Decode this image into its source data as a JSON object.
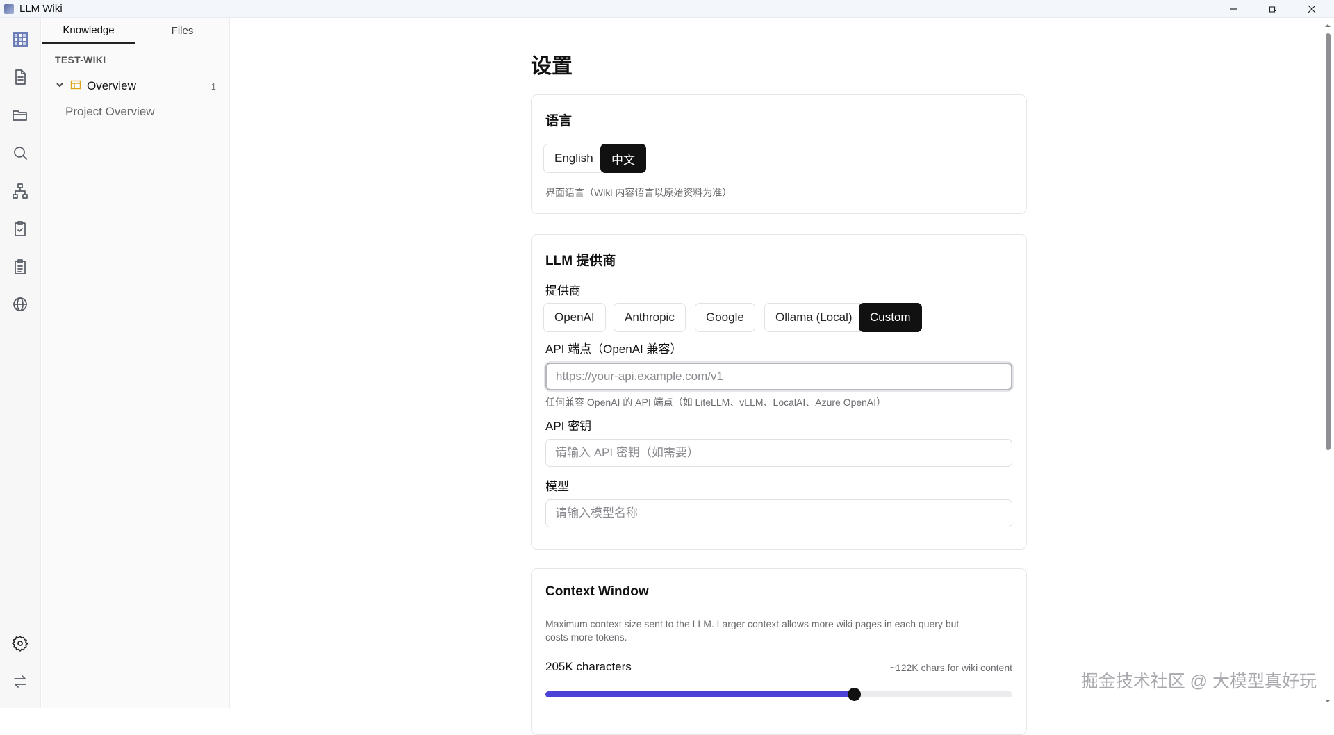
{
  "window": {
    "title": "LLM Wiki"
  },
  "rail": {
    "icons": [
      "grid-logo-icon",
      "document-icon",
      "folder-icon",
      "search-icon",
      "graph-icon",
      "clipboard-check-icon",
      "clipboard-list-icon",
      "globe-icon",
      "gear-icon",
      "swap-icon"
    ]
  },
  "sidebar": {
    "tabs": [
      {
        "label": "Knowledge",
        "active": true
      },
      {
        "label": "Files",
        "active": false
      }
    ],
    "wiki_name": "TEST-WIKI",
    "tree": {
      "label": "Overview",
      "count": "1",
      "children": [
        "Project Overview"
      ]
    }
  },
  "settings": {
    "title": "设置",
    "language": {
      "heading": "语言",
      "options": [
        "English",
        "中文"
      ],
      "selected": "中文",
      "hint": "界面语言（Wiki 内容语言以原始资料为准）"
    },
    "llm": {
      "heading": "LLM 提供商",
      "provider_label": "提供商",
      "providers": [
        "OpenAI",
        "Anthropic",
        "Google",
        "Ollama (Local)",
        "Custom"
      ],
      "selected": "Custom",
      "endpoint_label": "API 端点（OpenAI 兼容）",
      "endpoint_value": "",
      "endpoint_placeholder": "https://your-api.example.com/v1",
      "endpoint_hint": "任何兼容 OpenAI 的 API 端点（如 LiteLLM、vLLM、LocalAI、Azure OpenAI）",
      "key_label": "API 密钥",
      "key_placeholder": "请输入 API 密钥（如需要）",
      "model_label": "模型",
      "model_placeholder": "请输入模型名称"
    },
    "context": {
      "heading": "Context Window",
      "desc_line1": "Maximum context size sent to the LLM. Larger context allows more wiki pages in each query but",
      "desc_line2": "costs more tokens.",
      "value_label": "205K characters",
      "side_note": "~122K chars for wiki content",
      "slider_fraction": 0.66
    }
  },
  "watermark": "掘金技术社区 @ 大模型真好玩",
  "colors": {
    "accent": "#4a43d6",
    "selected_bg": "#111111"
  }
}
